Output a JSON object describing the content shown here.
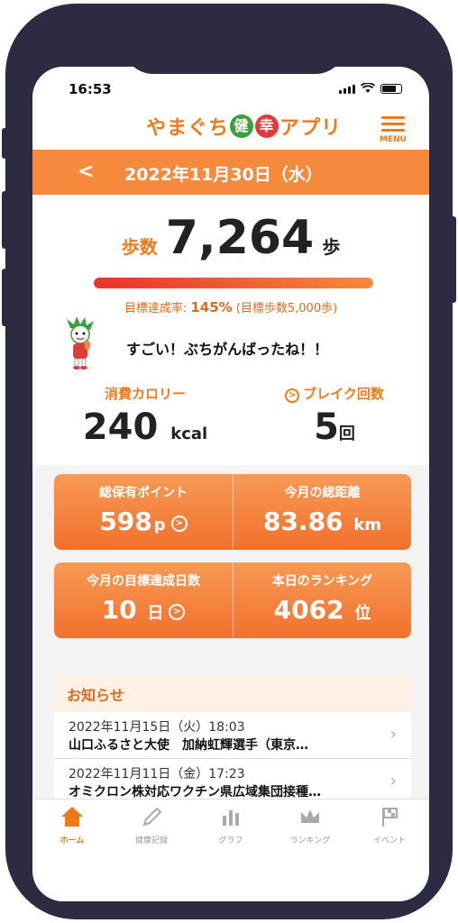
{
  "status": {
    "time": "16:53"
  },
  "header": {
    "logo_pre": "やまぐち",
    "logo_ken": "健",
    "logo_ko": "幸",
    "logo_post": "アプリ",
    "menu_label": "MENU"
  },
  "datebar": {
    "back": "<",
    "date": "2022年11月30日（水）"
  },
  "steps": {
    "label": "歩数",
    "value": "7,264",
    "unit": "歩",
    "progress": 1.0,
    "goal_prefix": "目標達成率: ",
    "goal_rate": "145%",
    "goal_suffix": " (目標歩数5,000歩)"
  },
  "message": "すごい！ぶちがんばったね！！",
  "stats": {
    "calorie_label": "消費カロリー",
    "calorie_value": "240",
    "calorie_unit": "kcal",
    "break_label": "ブレイク回数",
    "break_value": "5",
    "break_unit": "回"
  },
  "cards": {
    "points_label": "総保有ポイント",
    "points_value": "598",
    "points_unit": "p",
    "distance_label": "今月の総距離",
    "distance_value": "83.86",
    "distance_unit": "km",
    "goal_days_label": "今月の目標達成日数",
    "goal_days_value": "10",
    "goal_days_unit": "日",
    "ranking_label": "本日のランキング",
    "ranking_value": "4062",
    "ranking_unit": "位"
  },
  "news": {
    "title": "お知らせ",
    "items": [
      {
        "date": "2022年11月15日（火）18:03",
        "text": "山口ふるさと大使　加納虹輝選手（東京…"
      },
      {
        "date": "2022年11月11日（金）17:23",
        "text": "オミクロン株対応ワクチン県広域集団接種…"
      }
    ]
  },
  "tabs": [
    "ホーム",
    "健康記録",
    "グラフ",
    "ランキング",
    "イベント"
  ],
  "colors": {
    "accent": "#f07a1a",
    "card": "#f2702c",
    "frame": "#2b2c42"
  }
}
